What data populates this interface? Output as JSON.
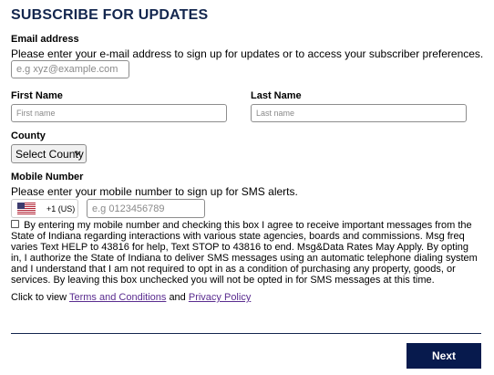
{
  "header": {
    "title": "SUBSCRIBE FOR UPDATES"
  },
  "email": {
    "label": "Email address",
    "description": "Please enter your e-mail address to sign up for updates or to access your subscriber preferences.",
    "placeholder": "e.g xyz@example.com"
  },
  "first_name": {
    "label": "First Name",
    "placeholder": "First name"
  },
  "last_name": {
    "label": "Last Name",
    "placeholder": "Last name"
  },
  "county": {
    "label": "County",
    "selected": "Select County"
  },
  "mobile": {
    "label": "Mobile Number",
    "description": "Please enter your mobile number to sign up for SMS alerts.",
    "country_code": "+1 (US)",
    "country_flag": "us-flag-icon",
    "placeholder": "e.g 0123456789"
  },
  "consent": {
    "text": "By entering my mobile number and checking this box I agree to receive important messages from the State of Indiana regarding interactions with various state agencies, boards and commissions. Msg freq varies Text HELP to 43816 for help, Text STOP to 43816 to end. Msg&Data Rates May Apply. By opting in, I authorize the State of Indiana to deliver SMS messages using an automatic telephone dialing system and I understand that I am not required to opt in as a condition of purchasing any property, goods, or services. By leaving this box unchecked you will not be opted in for SMS messages at this time.",
    "checked": false
  },
  "links": {
    "prefix": "Click to view",
    "terms": "Terms and Conditions",
    "and": "and",
    "privacy": "Privacy Policy"
  },
  "footer": {
    "next_label": "Next"
  },
  "colors": {
    "title": "#13264e",
    "button_bg": "#071a4d",
    "link": "#5a2c8f",
    "divider": "#13264e"
  }
}
